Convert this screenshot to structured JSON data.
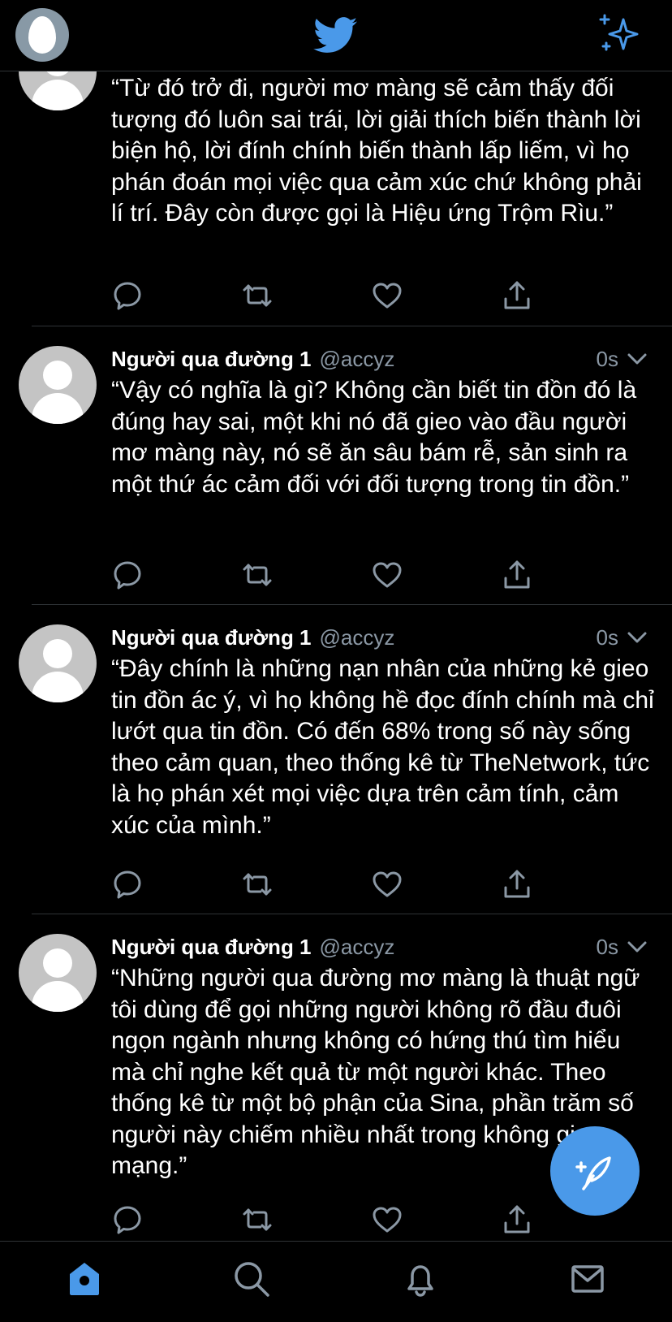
{
  "header": {
    "logo_icon": "twitter-bird-icon",
    "right_icon": "sparkle-icon",
    "accent": "#4a99e9"
  },
  "tweets": [
    {
      "name": "",
      "handle": "",
      "time": "",
      "text": "“Từ đó trở đi, người mơ màng sẽ cảm thấy đối tượng đó luôn sai trái, lời giải thích biến thành lời biện hộ, lời đính chính biến thành lấp liếm, vì họ phán đoán mọi việc qua cảm xúc chứ không phải lí trí. Đây còn được gọi là Hiệu ứng Trộm Rìu.”"
    },
    {
      "name": "Người qua đường 1",
      "handle": "@accyz",
      "time": "0s",
      "text": "“Vậy có nghĩa là gì? Không cần biết tin đồn đó là đúng hay sai, một khi nó đã gieo vào đầu người mơ màng này, nó sẽ ăn sâu bám rễ, sản sinh ra một thứ ác cảm đối với đối tượng trong tin đồn.”"
    },
    {
      "name": "Người qua đường 1",
      "handle": "@accyz",
      "time": "0s",
      "text": "“Đây chính là những nạn nhân của những kẻ gieo tin đồn ác ý, vì họ không hề đọc đính chính mà chỉ lướt qua tin đồn. Có đến 68% trong số này sống theo cảm quan, theo thống kê từ TheNetwork, tức là họ phán xét mọi việc dựa trên cảm tính, cảm xúc của mình.”"
    },
    {
      "name": "Người qua đường 1",
      "handle": "@accyz",
      "time": "0s",
      "text": "“Những người qua đường mơ màng là thuật ngữ tôi dùng để gọi những người không rõ đầu đuôi ngọn ngành nhưng không có hứng thú tìm hiểu mà chỉ nghe kết quả từ một người khác. Theo thống kê từ một bộ phận của Sina, phần trăm số người này chiếm nhiều nhất trong không gian mạng.”"
    }
  ],
  "action_icons": [
    "reply-icon",
    "retweet-icon",
    "like-icon",
    "share-icon"
  ],
  "fab": {
    "icon": "compose-feather-icon"
  },
  "bottom_nav": {
    "items": [
      "home-icon",
      "search-icon",
      "notifications-bell-icon",
      "messages-envelope-icon"
    ],
    "active": "home-icon"
  }
}
